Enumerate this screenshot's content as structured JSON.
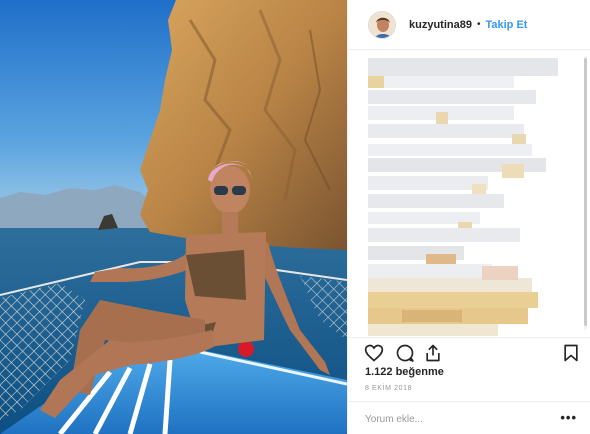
{
  "post": {
    "username": "kuzyutina89",
    "separator": "•",
    "follow_label": "Takip Et",
    "likes_text": "1.122 beğenme",
    "date_text": "8 EKİM 2018",
    "comment_placeholder": "Yorum ekle...",
    "more_options_label": "•••"
  },
  "icons": {
    "like": "heart-icon",
    "comment": "comment-bubble-icon",
    "share": "share-icon",
    "save": "bookmark-icon"
  },
  "colors": {
    "follow_blue": "#3897f0",
    "text": "#262626",
    "muted": "#999999",
    "divider": "#efefef"
  }
}
